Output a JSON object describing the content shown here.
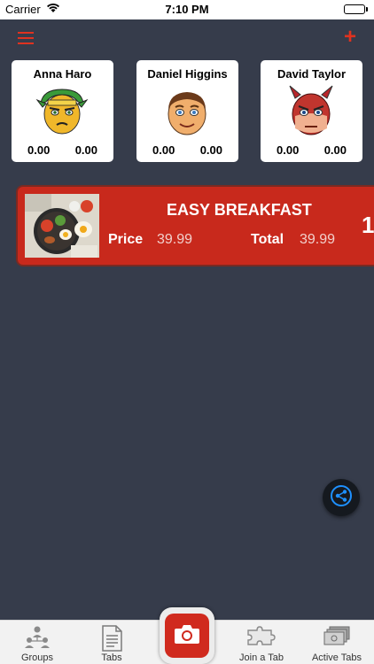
{
  "status_bar": {
    "carrier": "Carrier",
    "time": "7:10 PM"
  },
  "header": {
    "menu_icon": "hamburger-icon",
    "add_icon": "plus-icon",
    "add_symbol": "+"
  },
  "members": [
    {
      "name": "Anna Haro",
      "amount_left": "0.00",
      "amount_right": "0.00",
      "avatar": "green-helmet-avatar"
    },
    {
      "name": "Daniel Higgins",
      "amount_left": "0.00",
      "amount_right": "0.00",
      "avatar": "smiling-man-avatar"
    },
    {
      "name": "David Taylor",
      "amount_left": "0.00",
      "amount_right": "0.00",
      "avatar": "red-devil-avatar"
    }
  ],
  "item": {
    "title": "EASY BREAKFAST",
    "price_label": "Price",
    "price_value": "39.99",
    "total_label": "Total",
    "total_value": "39.99",
    "quantity": "1"
  },
  "tabs": [
    {
      "label": "Groups",
      "icon": "groups-icon"
    },
    {
      "label": "Tabs",
      "icon": "document-icon"
    },
    {
      "label": "Join a Tab",
      "icon": "puzzle-icon"
    },
    {
      "label": "Active Tabs",
      "icon": "stack-icon"
    }
  ],
  "colors": {
    "background": "#363c4b",
    "accent": "#e0321f",
    "item_card": "#c8291c",
    "share_icon": "#1e90ff"
  }
}
